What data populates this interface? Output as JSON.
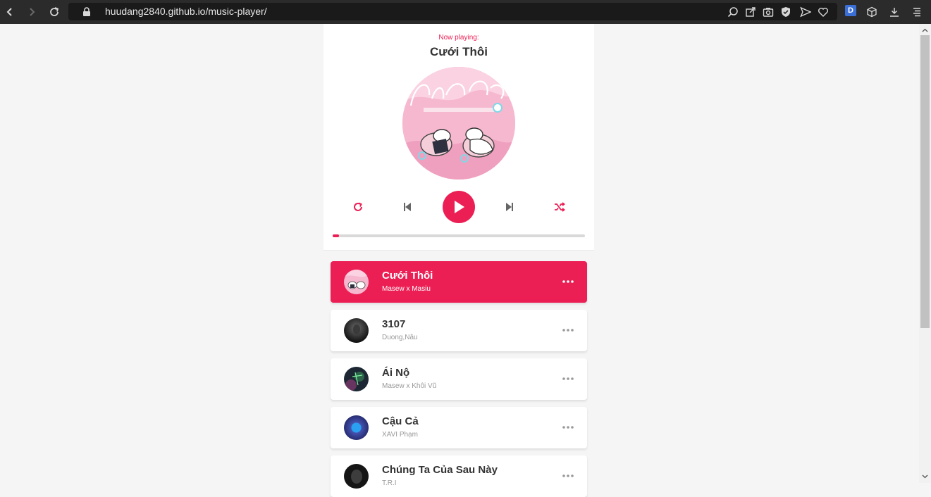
{
  "browser": {
    "url": "huudang2840.github.io/music-player/"
  },
  "player": {
    "now_playing_label": "Now playing:",
    "current_title": "Cưới Thôi",
    "accent_color": "#ec1f55",
    "progress_fraction": 0.025
  },
  "songs": [
    {
      "title": "Cưới Thôi",
      "author": "Masew x Masiu",
      "active": true
    },
    {
      "title": "3107",
      "author": "Duong,Nâu",
      "active": false
    },
    {
      "title": "Ái Nộ",
      "author": "Masew x Khôi Vũ",
      "active": false
    },
    {
      "title": "Cậu Cả",
      "author": "XAVI Phạm",
      "active": false
    },
    {
      "title": "Chúng Ta Của Sau Này",
      "author": "T.R.I",
      "active": false
    }
  ]
}
